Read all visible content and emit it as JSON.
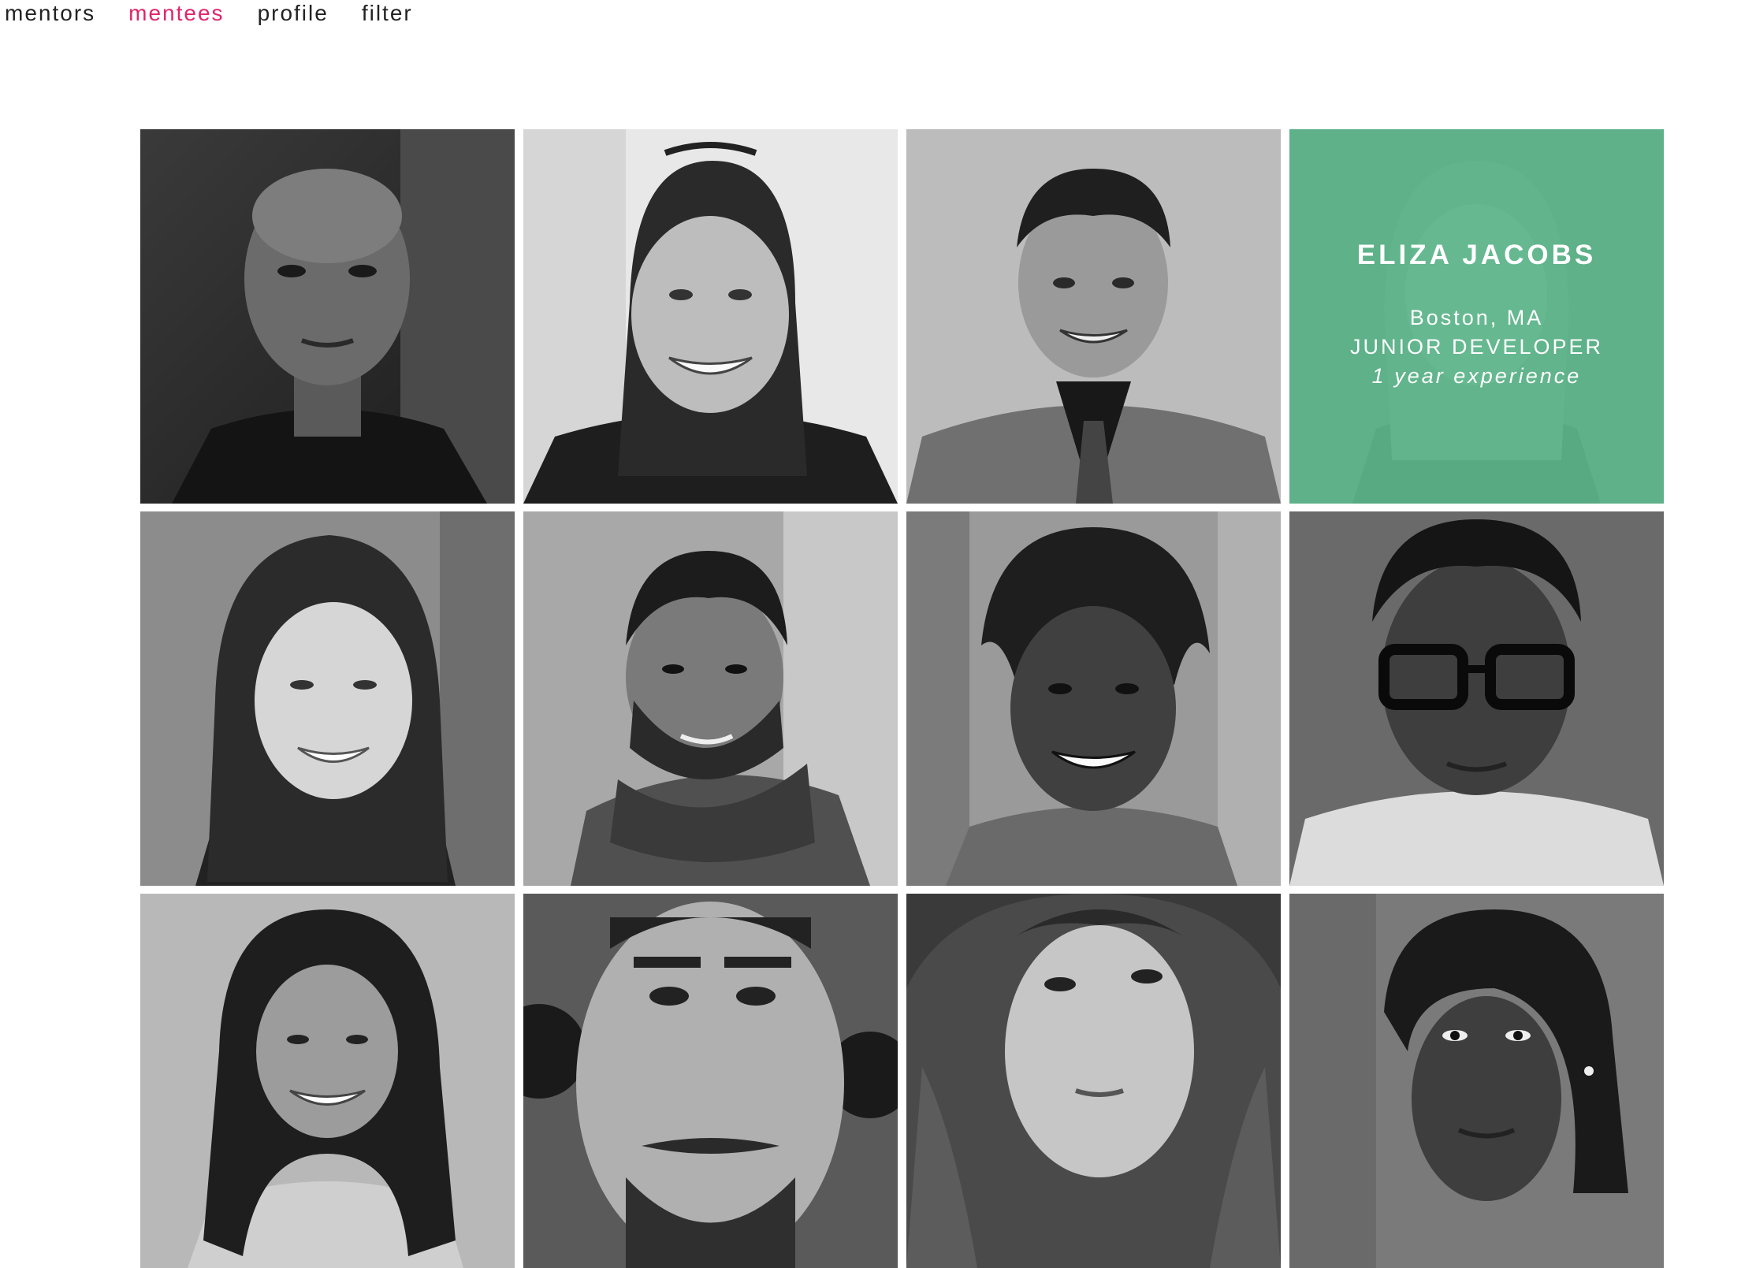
{
  "nav": {
    "items": [
      {
        "label": "mentors",
        "active": false
      },
      {
        "label": "mentees",
        "active": true
      },
      {
        "label": "profile",
        "active": false
      },
      {
        "label": "filter",
        "active": false
      }
    ]
  },
  "colors": {
    "accent": "#e0246c",
    "overlay": "#5eb88c"
  },
  "mentees": [
    {
      "photo": "bald-man-portrait"
    },
    {
      "photo": "smiling-woman-with-glasses-on-head-portrait"
    },
    {
      "photo": "young-man-in-suit-portrait"
    },
    {
      "photo": "woman-portrait",
      "highlighted": true,
      "name": "ELIZA JACOBS",
      "location": "Boston, MA",
      "role": "JUNIOR DEVELOPER",
      "experience": "1 year experience"
    },
    {
      "photo": "smiling-woman-long-hair-portrait"
    },
    {
      "photo": "bearded-man-with-scarf-portrait"
    },
    {
      "photo": "smiling-woman-curly-hair-portrait"
    },
    {
      "photo": "man-with-glasses-portrait"
    },
    {
      "photo": "smiling-woman-curly-hair-hoodie-portrait"
    },
    {
      "photo": "man-close-up-portrait"
    },
    {
      "photo": "woman-wavy-hair-portrait"
    },
    {
      "photo": "young-man-portrait"
    }
  ]
}
